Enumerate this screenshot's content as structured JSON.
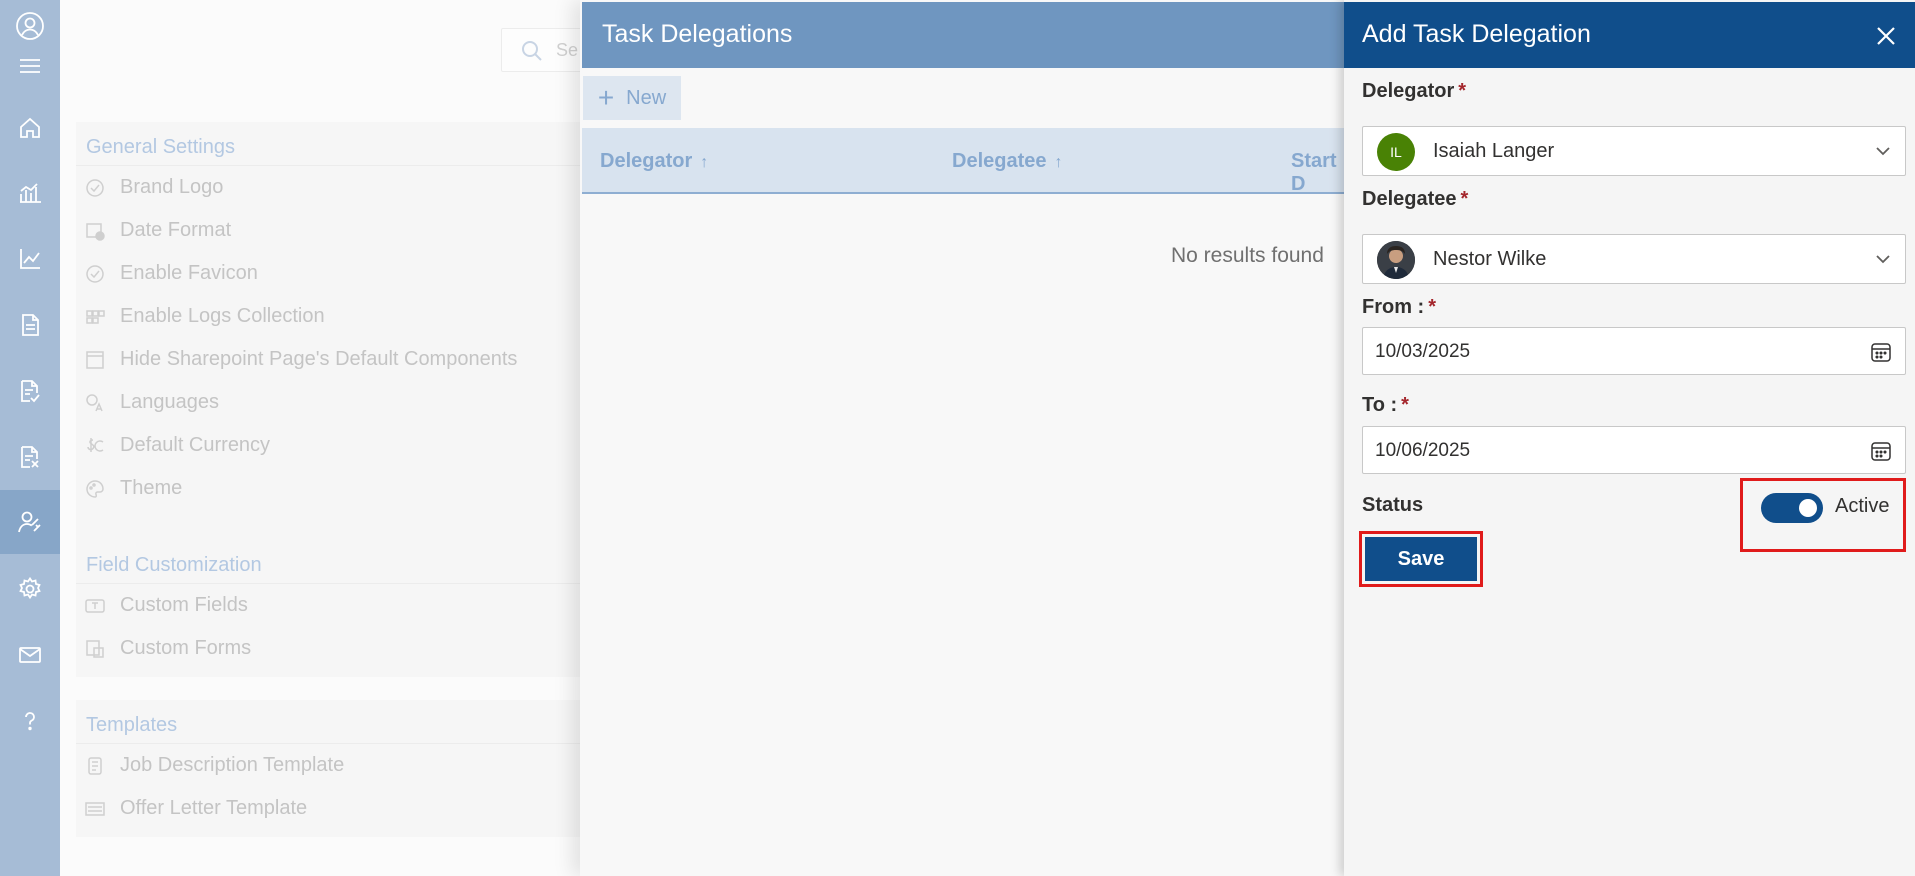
{
  "settings": {
    "search_placeholder": "Se",
    "sections": [
      {
        "title": "General Settings",
        "items": [
          {
            "label": "Brand Logo",
            "icon": "badge-check-icon"
          },
          {
            "label": "Date Format",
            "icon": "calendar-clock-icon"
          },
          {
            "label": "Enable Favicon",
            "icon": "badge-check-icon"
          },
          {
            "label": "Enable Logs Collection",
            "icon": "grid-icon"
          },
          {
            "label": "Hide Sharepoint Page's Default Components",
            "icon": "window-icon"
          },
          {
            "label": "Languages",
            "icon": "translate-icon"
          },
          {
            "label": "Default Currency",
            "icon": "currency-icon"
          },
          {
            "label": "Theme",
            "icon": "palette-icon"
          }
        ]
      },
      {
        "title": "Field Customization",
        "items": [
          {
            "label": "Custom Fields",
            "icon": "text-field-icon"
          },
          {
            "label": "Custom Forms",
            "icon": "form-icon"
          }
        ]
      },
      {
        "title": "Templates",
        "items": [
          {
            "label": "Job Description Template",
            "icon": "document-icon"
          },
          {
            "label": "Offer Letter Template",
            "icon": "letter-icon"
          }
        ]
      }
    ]
  },
  "task_delegations": {
    "title": "Task Delegations",
    "new_label": "New",
    "columns": [
      "Delegator",
      "Delegatee",
      "Start D"
    ],
    "empty_text": "No results found"
  },
  "flyout": {
    "title": "Add Task Delegation",
    "delegator_label": "Delegator",
    "delegator": {
      "initials": "IL",
      "name": "Isaiah Langer"
    },
    "delegatee_label": "Delegatee",
    "delegatee": {
      "name": "Nestor Wilke"
    },
    "from_label": "From :",
    "from_value": "10/03/2025",
    "to_label": "To :",
    "to_value": "10/06/2025",
    "required_mark": "*",
    "status_label": "Status",
    "status_value": "Active",
    "save_label": "Save"
  },
  "colors": {
    "primary": "#104e8b",
    "rail": "#a6bcd6",
    "highlight": "#e01b1b",
    "avatar_green": "#498205"
  }
}
